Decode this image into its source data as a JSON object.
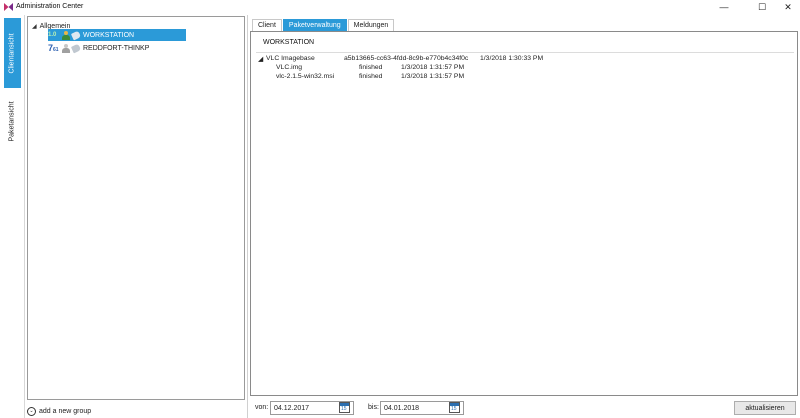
{
  "window": {
    "title": "Administration Center",
    "minimize_glyph": "—",
    "maximize_glyph": "☐",
    "close_glyph": "✕",
    "logo_colors": [
      "#c4306a",
      "#7a2a8a"
    ]
  },
  "sidebar": {
    "tabs": [
      {
        "label": "Clientansicht",
        "active": true
      },
      {
        "label": "Paketansicht",
        "active": false
      }
    ]
  },
  "tree": {
    "root": {
      "label": "Allgemein",
      "expand_glyph": "◢"
    },
    "items": [
      {
        "label": "WORKSTATION",
        "badge": "1.0",
        "icons": [
          "person-icon",
          "tag-icon"
        ],
        "selected": true
      },
      {
        "label": "REDDFORT-THINKP",
        "badge_main": "7",
        "badge_sub": "61",
        "icons": [
          "person-icon",
          "tag-icon"
        ],
        "selected": false
      }
    ]
  },
  "add_group": {
    "label": "add a new group",
    "glyph": "⌄"
  },
  "tabs": [
    {
      "label": "Client",
      "active": false
    },
    {
      "label": "Paketverwaltung",
      "active": true
    },
    {
      "label": "Meldungen",
      "active": false
    }
  ],
  "details": {
    "title": "WORKSTATION",
    "expand_glyph": "◢",
    "rows": [
      {
        "name": "VLC Imagebase",
        "status": "a5b13665-cc63-4fdd-8c9b-e770b4c34f0c",
        "time": "1/3/2018 1:30:33 PM"
      },
      {
        "name": "VLC.img",
        "status": "finished",
        "time": "1/3/2018 1:31:57 PM"
      },
      {
        "name": "vlc-2.1.5-win32.msi",
        "status": "finished",
        "time": "1/3/2018 1:31:57 PM"
      }
    ]
  },
  "filter": {
    "from_label": "von:",
    "from_value": "04.12.2017",
    "to_label": "bis:",
    "to_value": "04.01.2018",
    "calendar_day": "15",
    "refresh_label": "aktualisieren"
  },
  "colors": {
    "accent": "#2b9ad8"
  }
}
